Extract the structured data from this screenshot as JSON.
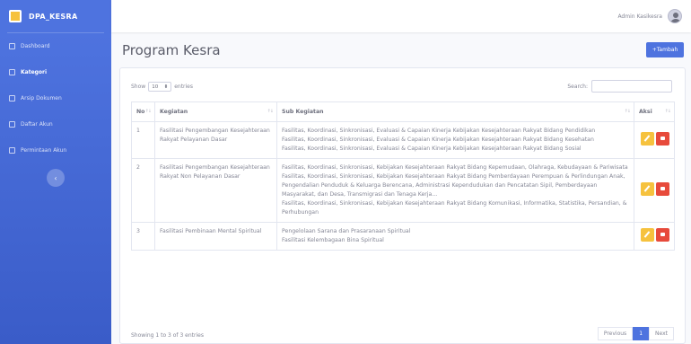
{
  "brand": {
    "name": "DPA_KESRA"
  },
  "sidebar": {
    "items": [
      {
        "label": "Dashboard",
        "icon": "dashboard-icon"
      },
      {
        "label": "Kategori",
        "icon": "folder-icon"
      },
      {
        "label": "Arsip Dokumen",
        "icon": "archive-icon"
      },
      {
        "label": "Daftar Akun",
        "icon": "users-icon"
      },
      {
        "label": "Permintaan Akun",
        "icon": "user-request-icon"
      }
    ],
    "toggle_icon": "‹"
  },
  "topbar": {
    "user_name": "Admin Kasikesra"
  },
  "page": {
    "title": "Program Kesra",
    "add_label": "+Tambah"
  },
  "controls": {
    "show_label": "Show",
    "entries_value": "10",
    "entries_label": "entries",
    "search_label": "Search:",
    "search_placeholder": ""
  },
  "table": {
    "headers": {
      "no": "No",
      "kegiatan": "Kegiatan",
      "sub": "Sub Kegiatan",
      "aksi": "Aksi"
    },
    "rows": [
      {
        "no": "1",
        "kegiatan": "Fasilitasi Pengembangan Kesejahteraan Rakyat Pelayanan Dasar",
        "sub": [
          "Fasilitas, Koordinasi, Sinkronisasi, Evaluasi & Capaian Kinerja Kebijakan Kesejahteraan Rakyat Bidang Pendidikan",
          "Fasilitas, Koordinasi, Sinkronisasi, Evaluasi & Capaian Kinerja Kebijakan Kesejahteraan Rakyat Bidang Kesehatan",
          "Fasilitas, Koordinasi, Sinkronisasi, Evaluasi & Capaian Kinerja Kebijakan Kesejahteraan Rakyat Bidang Sosial"
        ]
      },
      {
        "no": "2",
        "kegiatan": "Fasilitasi Pengembangan Kesejahteraan Rakyat Non Pelayanan Dasar",
        "sub": [
          "Fasilitas, Koordinasi, Sinkronisasi, Kebijakan Kesejahteraan Rakyat Bidang Kepemudaan, Olahraga, Kebudayaan & Pariwisata",
          "Fasilitas, Koordinasi, Sinkronisasi, Kebijakan Kesejahteraan Rakyat Bidang Pemberdayaan Perempuan & Perlindungan Anak, Pengendalian Penduduk & Keluarga Berencana, Administrasi Kependudukan dan Pencatatan Sipil, Pemberdayaan Masyarakat, dan Desa, Transmigrasi dan Tenaga Kerja...",
          "Fasilitas, Koordinasi, Sinkronisasi, Kebijakan Kesejahteraan Rakyat Bidang Komunikasi, Informatika, Statistika, Persandian, & Perhubungan"
        ]
      },
      {
        "no": "3",
        "kegiatan": "Fasilitasi Pembinaan Mental Spiritual",
        "sub": [
          "Pengelolaan Sarana dan Prasaranaan Spiritual",
          "Fasilitasi Kelembagaan Bina Spiritual"
        ]
      }
    ]
  },
  "footer": {
    "info": "Showing 1 to 3 of 3 entries",
    "previous": "Previous",
    "page": "1",
    "next": "Next"
  },
  "colors": {
    "primary": "#4e73df",
    "edit": "#f6c23e",
    "delete": "#e74a3b"
  }
}
